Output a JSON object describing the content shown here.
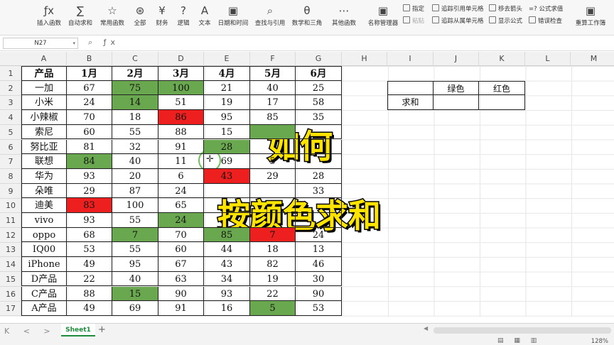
{
  "ribbon": {
    "insert_function": "插入函数",
    "autosum": "自动求和",
    "common": "常用函数",
    "all": "全部",
    "finance": "财务",
    "logic": "逻辑",
    "text": "文本",
    "datetime": "日期和时间",
    "lookup": "查找与引用",
    "math": "数学和三角",
    "other": "其他函数",
    "name_manager": "名称管理器",
    "define": "指定",
    "paste": "粘贴",
    "trace_prec": "追踪引用单元格",
    "trace_dep": "追踪从属单元格",
    "remove_arrows": "移去箭头",
    "show_formula": "显示公式",
    "formula_eval": "=? 公式求值",
    "error_check": "错误检查",
    "recalc": "重算工作簿",
    "icons": {
      "fx": "ƒx",
      "sigma": "∑",
      "star": "☆",
      "asterisk": "⊛",
      "yen": "¥",
      "question": "?",
      "A": "A",
      "calendar": "▣",
      "search": "⌕",
      "theta": "θ",
      "dots": "⋯"
    }
  },
  "formula_bar": {
    "name_box": "N27",
    "arrow": "▾",
    "fx_icons": "⌕ ƒx"
  },
  "columns": [
    "A",
    "B",
    "C",
    "D",
    "E",
    "F",
    "G",
    "H",
    "I",
    "J",
    "K",
    "L",
    "M"
  ],
  "rows": [
    "1",
    "2",
    "3",
    "4",
    "5",
    "6",
    "7",
    "8",
    "9",
    "10",
    "11",
    "12",
    "13",
    "14",
    "15",
    "16",
    "17"
  ],
  "table": {
    "header": [
      "产品",
      "1月",
      "2月",
      "3月",
      "4月",
      "5月",
      "6月"
    ],
    "rows": [
      [
        "一加",
        "67",
        "75",
        "100",
        "21",
        "40",
        "25"
      ],
      [
        "小米",
        "24",
        "14",
        "51",
        "19",
        "17",
        "58"
      ],
      [
        "小辣椒",
        "70",
        "18",
        "86",
        "95",
        "85",
        "35"
      ],
      [
        "索尼",
        "60",
        "55",
        "88",
        "15",
        "",
        ""
      ],
      [
        "努比亚",
        "81",
        "32",
        "91",
        "28",
        "",
        ""
      ],
      [
        "联想",
        "84",
        "40",
        "11",
        "69",
        "5",
        ""
      ],
      [
        "华为",
        "93",
        "20",
        "6",
        "43",
        "29",
        "28"
      ],
      [
        "朵唯",
        "29",
        "87",
        "24",
        "",
        "",
        "33"
      ],
      [
        "迪美",
        "83",
        "100",
        "65",
        "",
        "",
        ""
      ],
      [
        "vivo",
        "93",
        "55",
        "24",
        "",
        "",
        ""
      ],
      [
        "oppo",
        "68",
        "7",
        "70",
        "85",
        "7",
        "24"
      ],
      [
        "IQ00",
        "53",
        "55",
        "60",
        "44",
        "18",
        "13"
      ],
      [
        "iPhone",
        "49",
        "95",
        "67",
        "43",
        "82",
        "46"
      ],
      [
        "D产品",
        "22",
        "40",
        "63",
        "34",
        "19",
        "30"
      ],
      [
        "C产品",
        "88",
        "15",
        "90",
        "93",
        "22",
        "90"
      ],
      [
        "A产品",
        "49",
        "69",
        "91",
        "16",
        "5",
        "53"
      ]
    ]
  },
  "summary": {
    "green_label": "绿色",
    "red_label": "红色",
    "sum_label": "求和"
  },
  "overlay": {
    "line1": "如何",
    "line2": "按颜色求和"
  },
  "status": {
    "nav": "K < > K",
    "sheet_tab": "Sheet1",
    "add": "+",
    "zoom": "128%",
    "views": "▤ ▦ ▥"
  },
  "colors": {
    "green": "#6aa84f",
    "red": "#ee1f1f",
    "overlay_text": "#ffe400"
  }
}
